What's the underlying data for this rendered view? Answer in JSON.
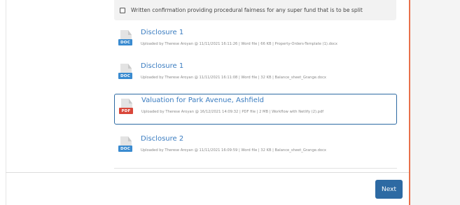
{
  "checkbox": {
    "label": "Written confirmation providing procedural fairness for any super fund that is to be split",
    "checked": false
  },
  "documents": [
    {
      "type": "DOC",
      "title": "Disclosure 1",
      "meta": "Uploaded by Therese Aroyan @ 11/11/2021 16:11:26 | Word file | 66 KB | Property-Orders-Template (1).docx",
      "selected": false
    },
    {
      "type": "DOC",
      "title": "Disclosure 1",
      "meta": "Uploaded by Therese Aroyan @ 11/11/2021 16:11:08 | Word file | 32 KB | Balance_sheet_Grange.docx",
      "selected": false
    },
    {
      "type": "PDF",
      "title": "Valuation for Park Avenue, Ashfield",
      "meta": "Uploaded by Therese Aroyan @ 16/12/2021 14:09:32 | PDF file | 2 MB | Workflow with Netlify (2).pdf",
      "selected": true
    },
    {
      "type": "DOC",
      "title": "Disclosure 2",
      "meta": "Uploaded by Therese Aroyan @ 11/11/2021 16:09:59 | Word file | 32 KB | Balance_sheet_Grange.docx",
      "selected": false
    }
  ],
  "footer": {
    "next_label": "Next"
  },
  "colors": {
    "accent": "#2d6aa3",
    "link": "#3a7cc0",
    "doc_badge": "#3a8bd0",
    "pdf_badge": "#d9473a",
    "side_border": "#e8704a"
  }
}
